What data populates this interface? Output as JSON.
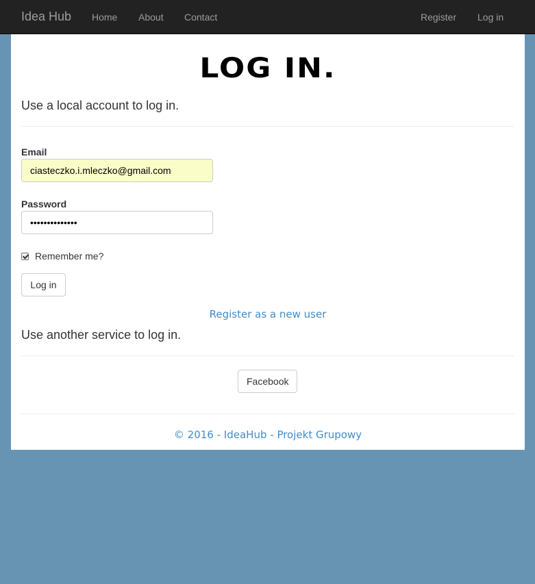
{
  "navbar": {
    "brand": "Idea Hub",
    "left_links": [
      "Home",
      "About",
      "Contact"
    ],
    "right_links": [
      "Register",
      "Log in"
    ]
  },
  "page": {
    "title": "LOG IN.",
    "local_heading": "Use a local account to log in.",
    "email_label": "Email",
    "email_value": "ciasteczko.i.mleczko@gmail.com",
    "password_label": "Password",
    "password_value": "••••••••••••••",
    "remember_label": "Remember me?",
    "remember_checked": true,
    "login_button": "Log in",
    "register_link": "Register as a new user",
    "external_heading": "Use another service to log in.",
    "facebook_button": "Facebook"
  },
  "footer": {
    "copyright": "© 2016",
    "sep1": " - ",
    "brand": "IdeaHub",
    "sep2": " - ",
    "project": "Projekt Grupowy"
  },
  "colors": {
    "background": "#6894b4",
    "navbar": "#222222",
    "link": "#428bca",
    "autofill": "#fafdc8"
  }
}
